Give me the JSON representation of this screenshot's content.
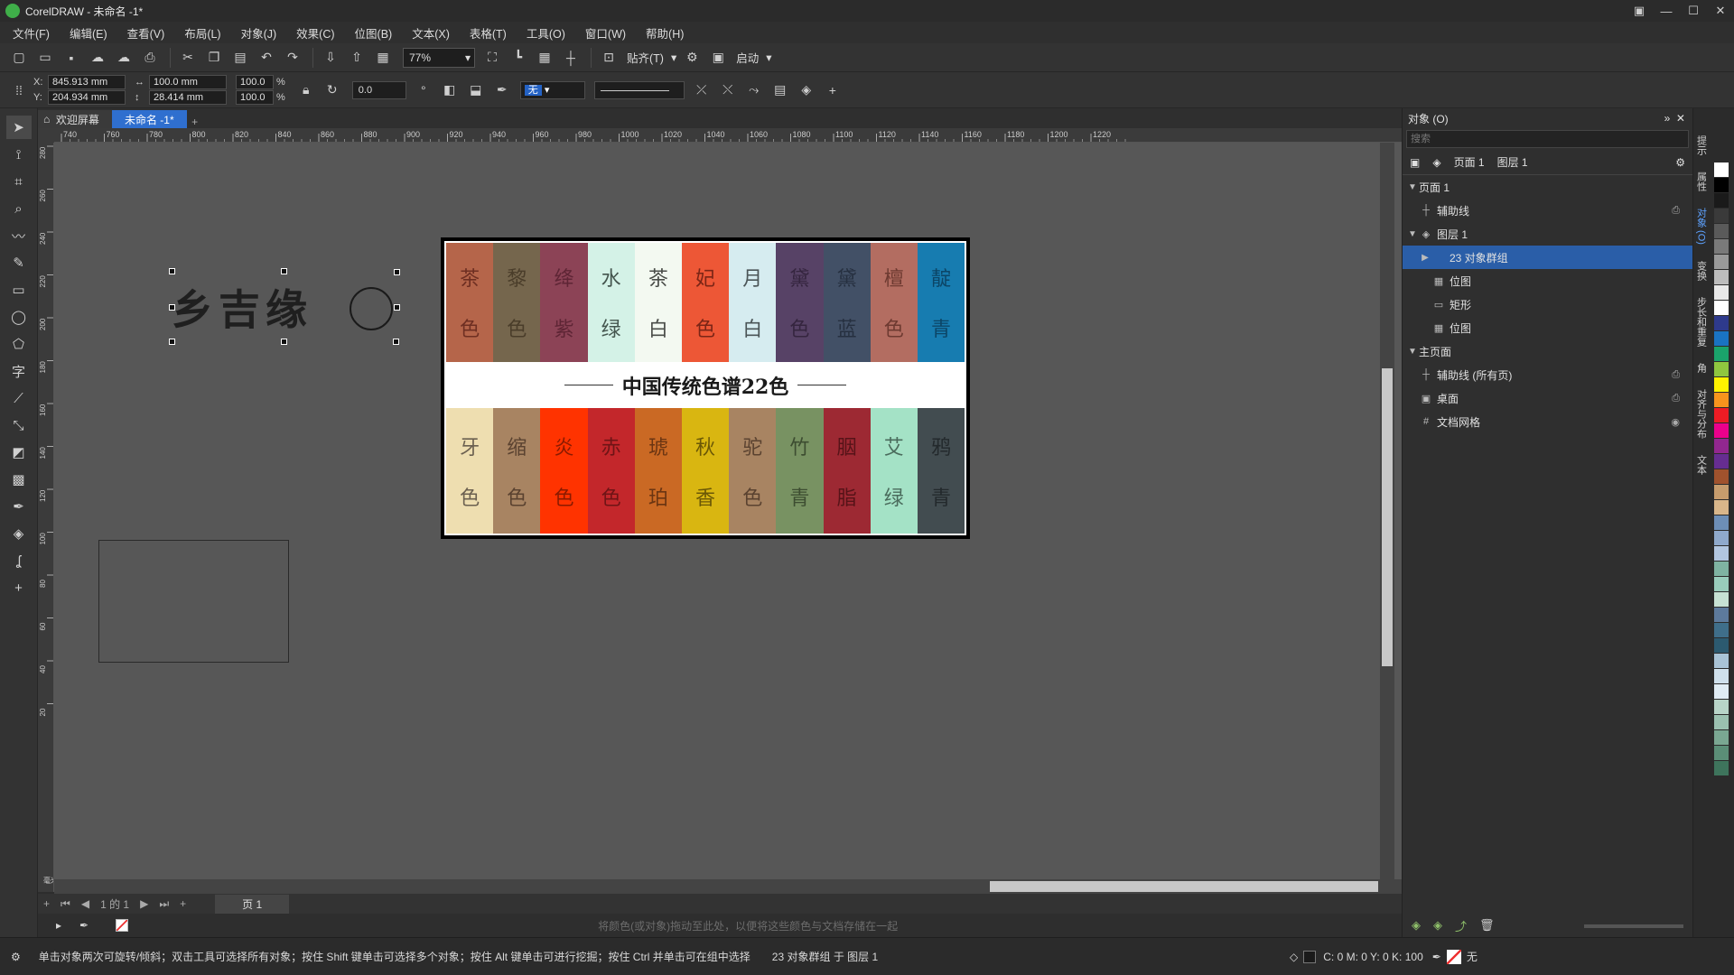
{
  "window": {
    "title": "CorelDRAW - 未命名 -1*"
  },
  "menu": [
    "文件(F)",
    "编辑(E)",
    "查看(V)",
    "布局(L)",
    "对象(J)",
    "效果(C)",
    "位图(B)",
    "文本(X)",
    "表格(T)",
    "工具(O)",
    "窗口(W)",
    "帮助(H)"
  ],
  "toolbar": {
    "zoom": "77%",
    "snap_label": "贴齐(T)",
    "launch_label": "启动"
  },
  "propbar": {
    "x": "845.913 mm",
    "y": "204.934 mm",
    "width": "100.0 mm",
    "height": "28.414 mm",
    "scale_x": "100.0",
    "scale_y": "100.0",
    "pct": "%",
    "rotation": "0.0",
    "outline_fill": "无"
  },
  "tabs": {
    "welcome": "欢迎屏幕",
    "doc": "未命名 -1*"
  },
  "ruler": {
    "h_ticks": [
      "740",
      "760",
      "780",
      "800",
      "820",
      "840",
      "860",
      "880",
      "900",
      "920",
      "940",
      "960",
      "980",
      "1000",
      "1020",
      "1040",
      "1060",
      "1080",
      "1100",
      "1120",
      "1140",
      "1160",
      "1180",
      "1200",
      "1220"
    ],
    "v_ticks": [
      "280",
      "260",
      "240",
      "220",
      "200",
      "180",
      "160",
      "140",
      "120",
      "100",
      "80",
      "60",
      "40",
      "20"
    ],
    "unit": "毫米"
  },
  "artwork": {
    "logo_text": "乡吉缘",
    "banner": "中国传统色谱22色",
    "top_colors": [
      {
        "t1": "茶",
        "t2": "色",
        "bg": "#b5654a",
        "fg": "#6e2f22"
      },
      {
        "t1": "黎",
        "t2": "色",
        "bg": "#75664d",
        "fg": "#4a3d2a"
      },
      {
        "t1": "绛",
        "t2": "紫",
        "bg": "#8c4356",
        "fg": "#5e2535"
      },
      {
        "t1": "水",
        "t2": "绿",
        "bg": "#d4f2e7",
        "fg": "#44554e"
      },
      {
        "t1": "茶",
        "t2": "白",
        "bg": "#f3f9f1",
        "fg": "#4a4d49"
      },
      {
        "t1": "妃",
        "t2": "色",
        "bg": "#ed5736",
        "fg": "#7a2516"
      },
      {
        "t1": "月",
        "t2": "白",
        "bg": "#d6ecf0",
        "fg": "#4b5557"
      },
      {
        "t1": "黛",
        "t2": "色",
        "bg": "#574266",
        "fg": "#35253f"
      },
      {
        "t1": "黛",
        "t2": "蓝",
        "bg": "#425066",
        "fg": "#263040"
      },
      {
        "t1": "檀",
        "t2": "色",
        "bg": "#b36d61",
        "fg": "#6e3a31"
      },
      {
        "t1": "靛",
        "t2": "青",
        "bg": "#177cb0",
        "fg": "#0c4566"
      }
    ],
    "bottom_colors": [
      {
        "t1": "牙",
        "t2": "色",
        "bg": "#eedeb0",
        "fg": "#6b6050"
      },
      {
        "t1": "缩",
        "t2": "色",
        "bg": "#a88462",
        "fg": "#5a4230"
      },
      {
        "t1": "炎",
        "t2": "色",
        "bg": "#ff3300",
        "fg": "#8a1a00"
      },
      {
        "t1": "赤",
        "t2": "色",
        "bg": "#c3272b",
        "fg": "#6e1416"
      },
      {
        "t1": "琥",
        "t2": "珀",
        "bg": "#ca6924",
        "fg": "#6b3512"
      },
      {
        "t1": "秋",
        "t2": "香",
        "bg": "#d9b611",
        "fg": "#6b5806"
      },
      {
        "t1": "驼",
        "t2": "色",
        "bg": "#a88462",
        "fg": "#5a4230"
      },
      {
        "t1": "竹",
        "t2": "青",
        "bg": "#789262",
        "fg": "#3d4d31"
      },
      {
        "t1": "胭",
        "t2": "脂",
        "bg": "#9d2933",
        "fg": "#561318"
      },
      {
        "t1": "艾",
        "t2": "绿",
        "bg": "#a4e2c6",
        "fg": "#4a6b5c"
      },
      {
        "t1": "鸦",
        "t2": "青",
        "bg": "#424c50",
        "fg": "#23292c"
      }
    ]
  },
  "pagebar": {
    "page_of": "1 的 1",
    "page_tab": "页 1"
  },
  "palette_hint": "将颜色(或对象)拖动至此处，以便将这些颜色与文档存储在一起",
  "status": {
    "hint": "单击对象两次可旋转/倾斜；双击工具可选择所有对象；按住 Shift 键单击可选择多个对象；按住 Alt 键单击可进行挖掘；按住 Ctrl 并单击可在组中选择",
    "selection": "23 对象群组 于 图层 1",
    "fill_info": "C: 0 M: 0 Y: 0 K: 100",
    "outline": "无"
  },
  "objects_panel": {
    "title": "对象 (O)",
    "search_placeholder": "搜索",
    "header_page": "页面 1",
    "header_layer": "图层 1",
    "tree": {
      "page1": "页面 1",
      "guides": "辅助线",
      "layer1": "图层 1",
      "group": "23 对象群组",
      "bitmap1": "位图",
      "rect": "矩形",
      "bitmap2": "位图",
      "master": "主页面",
      "guides_all": "辅助线 (所有页)",
      "desktop": "桌面",
      "docgrid": "文档网格"
    }
  },
  "docker_tabs": [
    "提示",
    "属性",
    "对象 (O)",
    "变换",
    "步长和重复",
    "角",
    "对齐与分布",
    "文本"
  ],
  "palette_colors": [
    "#ffffff",
    "#000000",
    "#1a1a1a",
    "#3a3a3a",
    "#5a5a5a",
    "#7a7a7a",
    "#9a9a9a",
    "#bcbcbc",
    "#e8e8e8",
    "#ffffff",
    "#2e3a8c",
    "#1a73c2",
    "#1aa36b",
    "#8fc63f",
    "#fff200",
    "#f7941d",
    "#ed1c24",
    "#ec008c",
    "#92278f",
    "#662d91",
    "#a0522d",
    "#c69c6d",
    "#d9b68a",
    "#6d8eb6",
    "#8fa9cc",
    "#b2c6e0",
    "#7fb3a2",
    "#99ccbb",
    "#c7e2d4",
    "#5d7a9c",
    "#3f6e8a",
    "#2c5a70",
    "#a9c3d6",
    "#cfe0ec",
    "#e0ecf4",
    "#b8d4c8",
    "#9bc0b0",
    "#7aa792",
    "#5b8e77",
    "#3e745c"
  ]
}
